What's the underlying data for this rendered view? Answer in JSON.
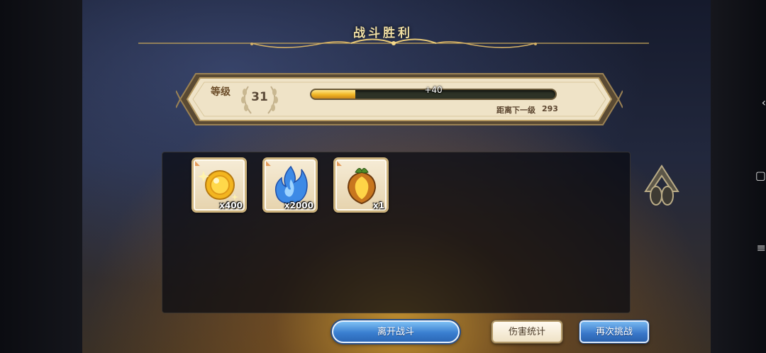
{
  "screen": {
    "title": "战斗胜利"
  },
  "level": {
    "label": "等级",
    "value": "31",
    "xp_gain": "+40",
    "xp_progress": 0.18,
    "next_label": "距离下一级",
    "next_value": "293"
  },
  "rewards": [
    {
      "icon": "gold-coin-icon",
      "qty": "x400"
    },
    {
      "icon": "blue-flame-icon",
      "qty": "x2000"
    },
    {
      "icon": "golden-fruit-icon",
      "qty": "x1"
    }
  ],
  "buttons": {
    "leave": "离开战斗",
    "damage_stats": "伤害统计",
    "retry": "再次挑战"
  },
  "colors": {
    "title_gold": "#f1dfa3",
    "xp_fill": "#f0b524",
    "primary_button": "#3a7fd0"
  }
}
